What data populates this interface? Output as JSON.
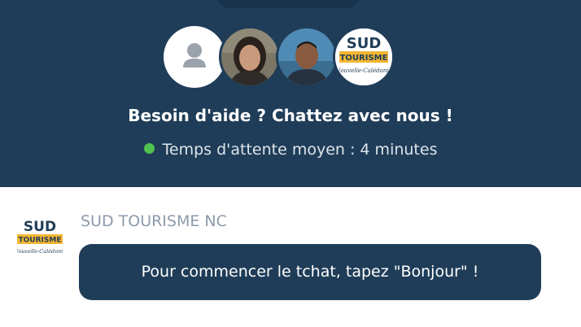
{
  "header": {
    "title": "Besoin d'aide ? Chattez avec nous !",
    "status_text": "Temps d'attente moyen : 4 minutes",
    "status_color": "#4fc24f",
    "background_color": "#1f3d58",
    "avatars": [
      {
        "icon": "default-user-icon"
      },
      {
        "icon": "agent-photo"
      },
      {
        "icon": "agent-photo"
      },
      {
        "icon": "company-logo"
      }
    ]
  },
  "messages": [
    {
      "sender": "SUD TOURISME NC",
      "avatar_icon": "company-logo",
      "text": "Pour commencer le tchat, tapez \"Bonjour\" !"
    }
  ],
  "logo": {
    "word1": "SUD",
    "word2": "TOURISME",
    "word3": "Nouvelle-Calédonie"
  }
}
